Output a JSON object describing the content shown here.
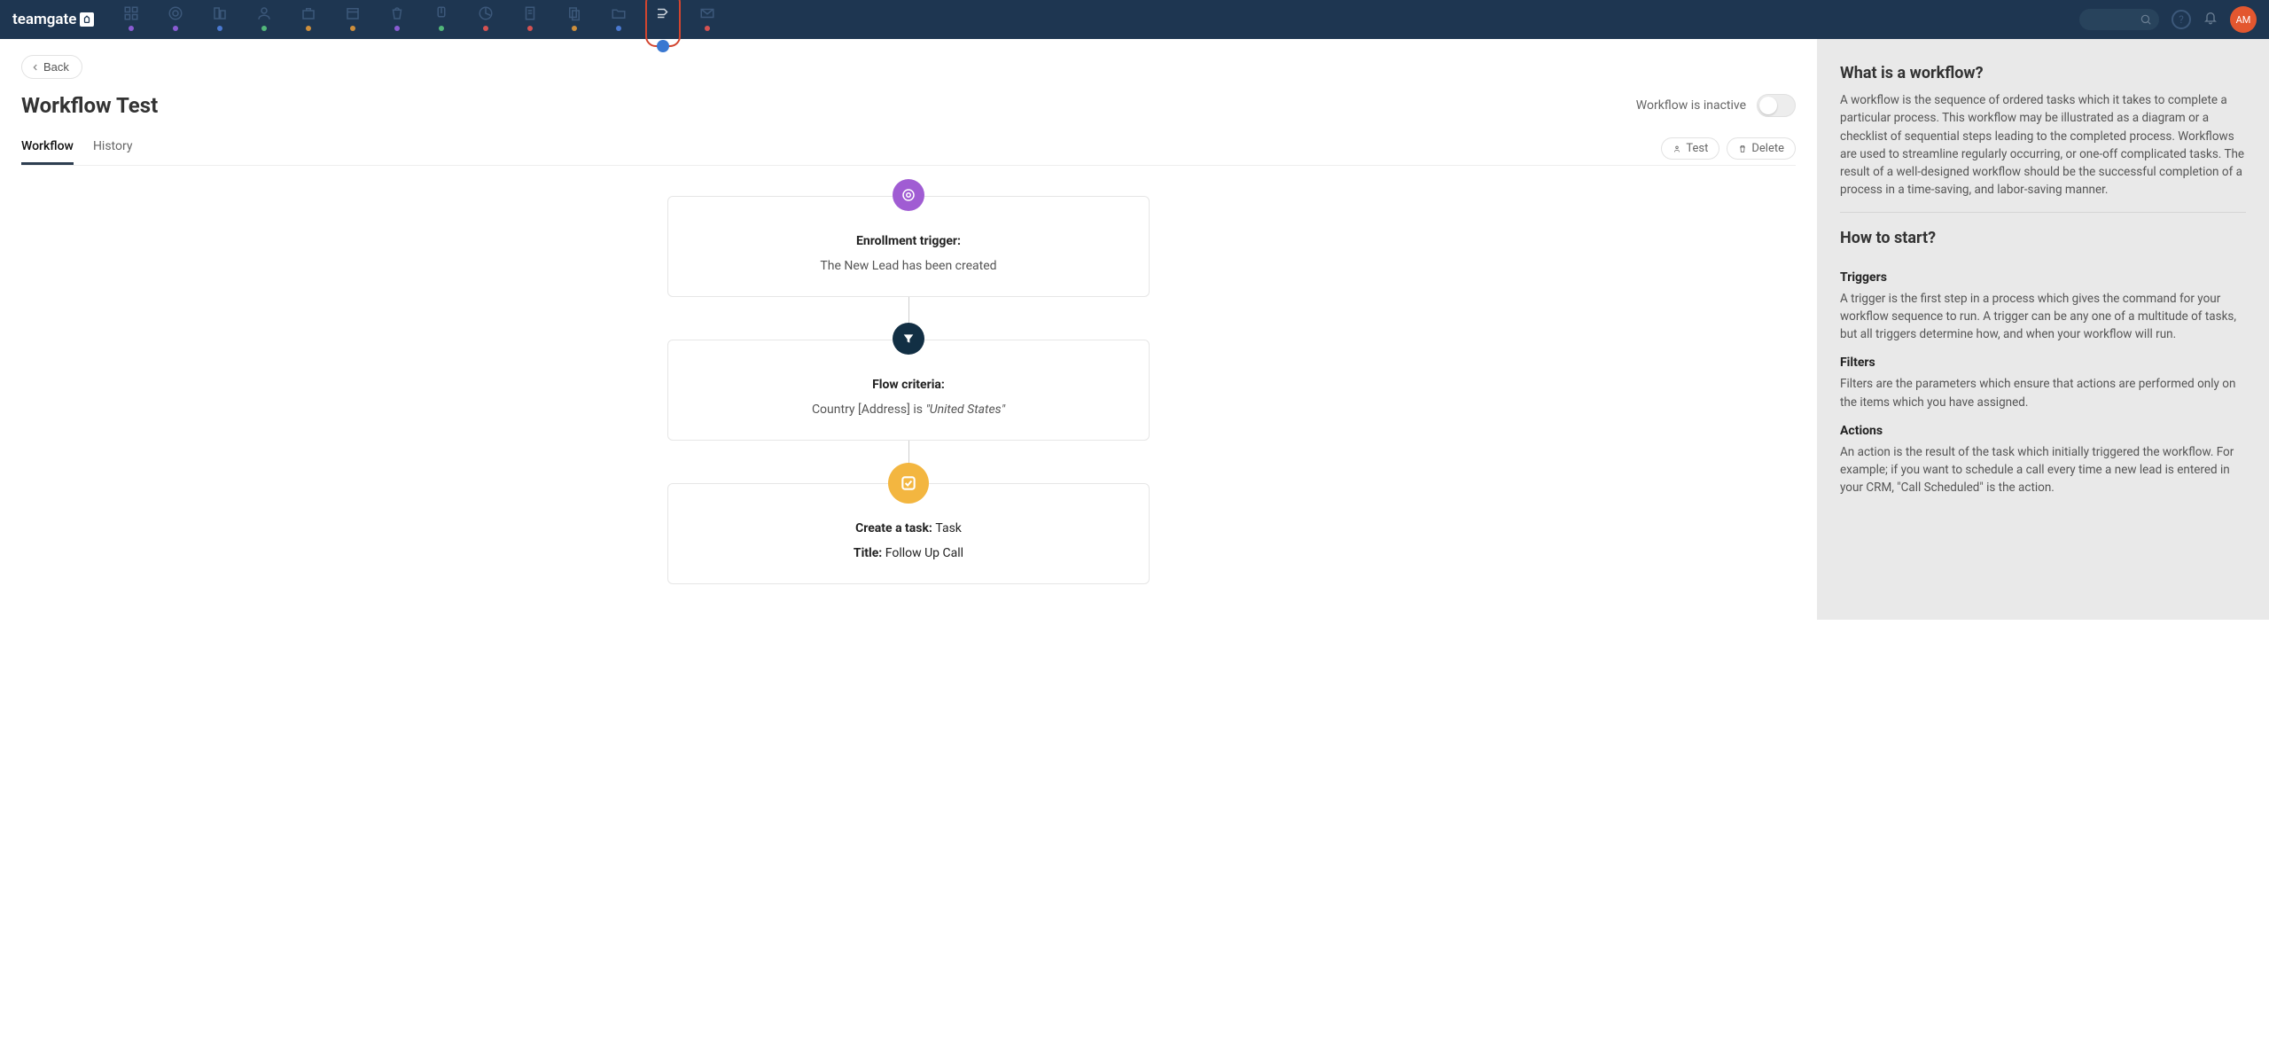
{
  "app": {
    "logo_text": "teamgate",
    "search_placeholder": "",
    "avatar_initials": "AM",
    "nav_items": [
      {
        "name": "dashboard",
        "dot": "#8a5cd3"
      },
      {
        "name": "target",
        "dot": "#8a5cd3"
      },
      {
        "name": "companies",
        "dot": "#4a79d1"
      },
      {
        "name": "contacts",
        "dot": "#52b77a"
      },
      {
        "name": "deals",
        "dot": "#ce8f3c"
      },
      {
        "name": "calendar",
        "dot": "#ce8f3c"
      },
      {
        "name": "products",
        "dot": "#8a5cd3"
      },
      {
        "name": "attachments",
        "dot": "#52b77a"
      },
      {
        "name": "analytics",
        "dot": "#d55252"
      },
      {
        "name": "notes",
        "dot": "#d55252"
      },
      {
        "name": "documents",
        "dot": "#ce8f3c"
      },
      {
        "name": "folders",
        "dot": "#4a79d1"
      },
      {
        "name": "workflows",
        "dot": "#4a79d1"
      },
      {
        "name": "mail",
        "dot": "#d55252"
      }
    ]
  },
  "page": {
    "back_label": "Back",
    "title": "Workflow Test",
    "status_text": "Workflow is inactive",
    "tabs": [
      "Workflow",
      "History"
    ],
    "actions": {
      "test": "Test",
      "delete": "Delete"
    }
  },
  "flow": {
    "enrollment": {
      "title": "Enrollment trigger:",
      "body": "The New Lead has been created"
    },
    "criteria": {
      "title": "Flow criteria:",
      "body_prefix": "Country [Address] is ",
      "body_value": "\"United States\""
    },
    "task": {
      "prefix": "Create a task: ",
      "type": "Task",
      "title_label_prefix": "Title: ",
      "title_value": "Follow Up Call"
    }
  },
  "sidebar": {
    "s1_title": "What is a workflow?",
    "s1_body": "A workflow is the sequence of ordered tasks which it takes to complete a particular process. This workflow may be illustrated as a diagram or a checklist of sequential steps leading to the completed process. Workflows are used to streamline regularly occurring, or one-off complicated tasks. The result of a well-designed workflow should be the successful completion of a process in a time-saving, and labor-saving manner.",
    "s2_title": "How to start?",
    "s3_title": "Triggers",
    "s3_body": "A trigger is the first step in a process which gives the command for your workflow sequence to run. A trigger can be any one of a multitude of tasks, but all triggers determine how, and when your workflow will run.",
    "s4_title": "Filters",
    "s4_body": "Filters are the parameters which ensure that actions are performed only on the items which you have assigned.",
    "s5_title": "Actions",
    "s5_body": "An action is the result of the task which initially triggered the workflow. For example; if you want to schedule a call every time a new lead is entered in your CRM, \"Call Scheduled\" is the action."
  }
}
